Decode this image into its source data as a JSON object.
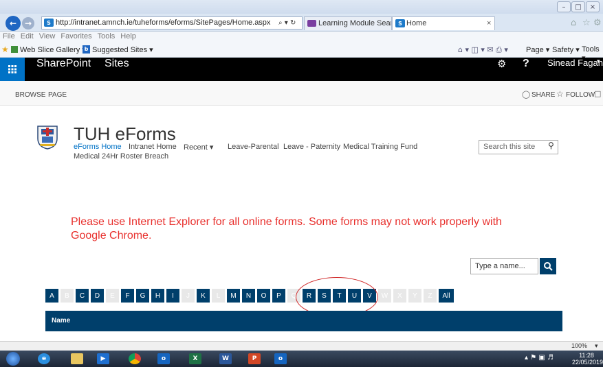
{
  "browser": {
    "window_title": "",
    "address": "http://intranet.amnch.ie/tuheforms/eforms/SitePages/Home.aspx",
    "address_controls": "⌕ ▾ ↻",
    "tabs": [
      {
        "label": "Learning Module Search: NetD..."
      },
      {
        "label": "Home"
      }
    ],
    "tab_close": "×",
    "menu": [
      "File",
      "Edit",
      "View",
      "Favorites",
      "Tools",
      "Help"
    ],
    "favorites": [
      "Web Slice Gallery ▾",
      "Suggested Sites ▾"
    ],
    "command_bar": [
      "Page ▾",
      "Safety ▾",
      "Tools ▾"
    ]
  },
  "suitebar": {
    "app_name": "SharePoint",
    "sites": "Sites",
    "help": "?",
    "user": "Sinead Fagan"
  },
  "ribbon": {
    "browse": "BROWSE",
    "page": "PAGE",
    "share": "SHARE",
    "follow": "FOLLOW"
  },
  "site": {
    "title": "TUH eForms",
    "nav": [
      "eForms Home",
      "Intranet Home",
      "Recent ▾",
      "Leave-Parental",
      "Leave - Paternity",
      "Medical Training Fund"
    ],
    "nav_second_line": "Medical 24Hr Roster Breach",
    "search_placeholder": "Search this site"
  },
  "notice": "Please use Internet Explorer for all online forms. Some forms may not work properly with Google Chrome.",
  "people_search": {
    "placeholder": "Type a name..."
  },
  "alphabet": {
    "letters": [
      "A",
      "B",
      "C",
      "D",
      "E",
      "F",
      "G",
      "H",
      "I",
      "J",
      "K",
      "L",
      "M",
      "N",
      "O",
      "P",
      "Q",
      "R",
      "S",
      "T",
      "U",
      "V",
      "W",
      "X",
      "Y",
      "Z"
    ],
    "disabled": [
      "B",
      "E",
      "J",
      "L",
      "Q",
      "W",
      "X",
      "Y",
      "Z"
    ],
    "all_label": "All"
  },
  "list": {
    "column_name": "Name"
  },
  "statusbar": {
    "zoom": "100%"
  },
  "taskbar": {
    "time": "11:28",
    "date": "22/05/2019"
  },
  "colors": {
    "accent": "#0072c6",
    "nav_dark": "#003f6b",
    "notice_red": "#e8302d",
    "annotation_circle": "#d02828"
  }
}
